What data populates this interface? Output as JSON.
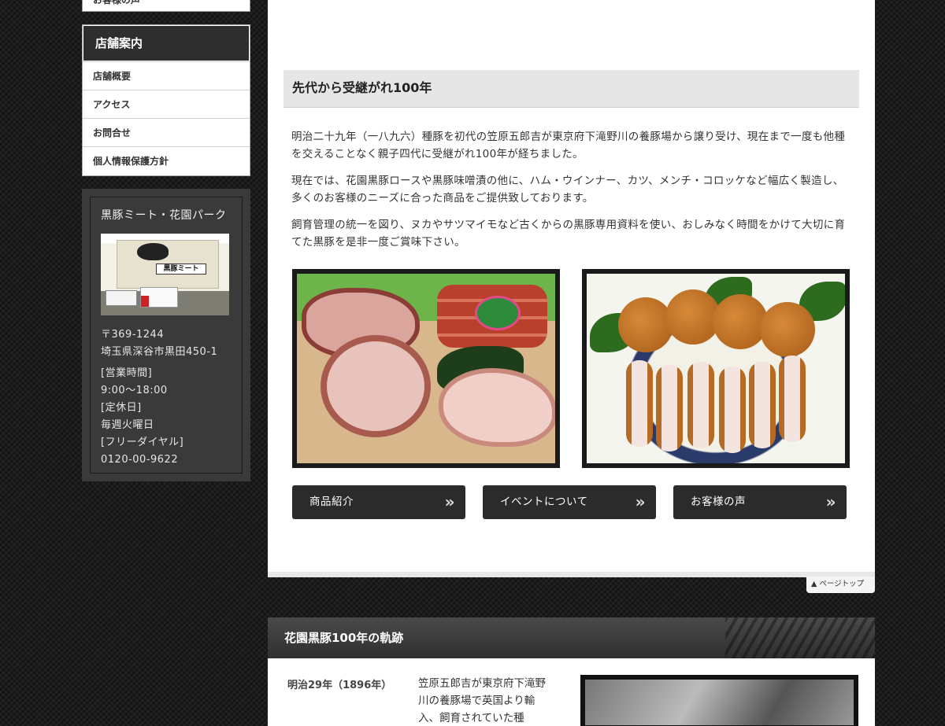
{
  "sidebar": {
    "top_stub_label": "お客様の声",
    "store_info": {
      "title": "店舗案内",
      "items": [
        {
          "label": "店舗概要"
        },
        {
          "label": "アクセス"
        },
        {
          "label": "お問合せ"
        },
        {
          "label": "個人情報保護方針"
        }
      ]
    },
    "shop": {
      "title": "黒豚ミート・花園パーク",
      "photo_sign": "黒豚ミート",
      "postal": "〒369-1244",
      "address": "埼玉県深谷市黒田450-1",
      "hours_label": "[営業時間]",
      "hours": "9:00〜18:00",
      "closed_label": "[定休日]",
      "closed": "毎週火曜日",
      "phone_label": "[フリーダイヤル]",
      "phone": "0120-00-9622"
    }
  },
  "main": {
    "section_title": "先代から受継がれ100年",
    "paragraphs": [
      "明治二十九年（一八九六）種豚を初代の笠原五郎吉が東京府下滝野川の養豚場から譲り受け、現在まで一度も他種を交えることなく親子四代に受継がれ100年が経ちました。",
      "現在では、花園黒豚ロースや黒豚味噌漬の他に、ハム・ウインナー、カツ、メンチ・コロッケなど幅広く製造し、多くのお客様のニーズに合った商品をご提供致しております。",
      "飼育管理の統一を図り、ヌカやサツマイモなど古くからの黒豚専用資料を使い、おしみなく時間をかけて大切に育てた黒豚を是非一度ご賞味下さい。"
    ],
    "buttons": [
      {
        "label": "商品紹介",
        "arrow": "»"
      },
      {
        "label": "イベントについて",
        "arrow": "»"
      },
      {
        "label": "お客様の声",
        "arrow": "»"
      }
    ],
    "page_top": "▲ ページトップ"
  },
  "history": {
    "title": "花園黒豚100年の軌跡",
    "year": "明治29年（1896年）",
    "text": "笠原五郎吉が東京府下滝野川の養豚場で英国より輸入、飼育されていた種"
  }
}
